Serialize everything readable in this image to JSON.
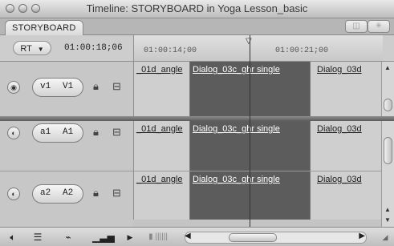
{
  "window": {
    "title": "Timeline: STORYBOARD in Yoga Lesson_basic"
  },
  "tabs": [
    {
      "label": "STORYBOARD"
    }
  ],
  "controls": {
    "rt_label": "RT",
    "current_timecode": "01:00:18;06"
  },
  "ruler": {
    "timecodes": [
      "01:00:14;00",
      "01:00:21;00"
    ]
  },
  "tracks": {
    "video": [
      {
        "source": "v1",
        "target": "V1"
      }
    ],
    "audio": [
      {
        "source": "a1",
        "target": "A1"
      },
      {
        "source": "a2",
        "target": "A2"
      }
    ],
    "clips": [
      {
        "name": "_01d_angle"
      },
      {
        "name": "Dialog_03c_ghr single"
      },
      {
        "name": "Dialog_03d"
      }
    ]
  },
  "icons": {
    "lock": "lock-icon",
    "sync": "sync-icon",
    "audio": "speaker-icon",
    "video_toggle": "eye-icon"
  },
  "colors": {
    "selected_clip": "#5c5c5c",
    "clip": "#cfcfcf",
    "track_bg": "#c9c9c9"
  }
}
